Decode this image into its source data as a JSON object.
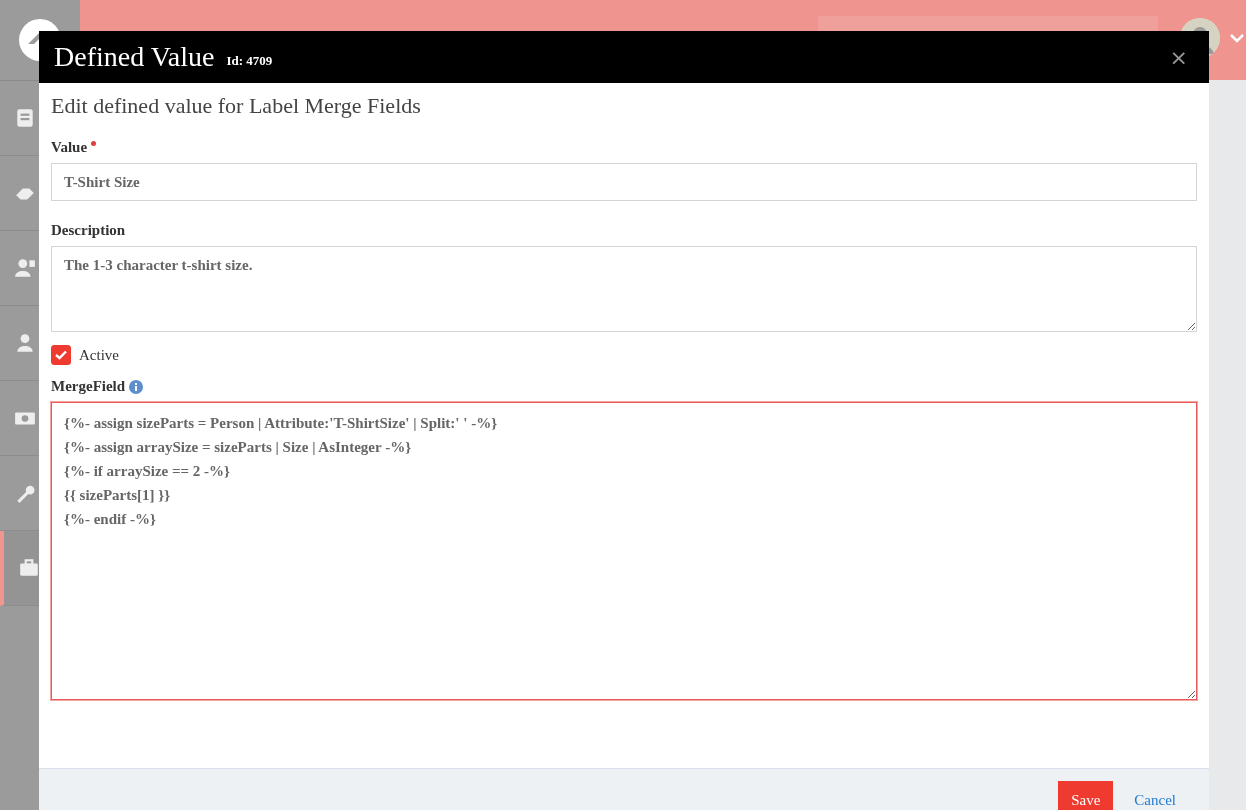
{
  "sidebar": {
    "items": [
      {
        "selected": false
      },
      {
        "selected": false
      },
      {
        "selected": false
      },
      {
        "selected": false
      },
      {
        "selected": false
      },
      {
        "selected": false
      },
      {
        "selected": true
      }
    ]
  },
  "dialog": {
    "title": "Defined Value",
    "id_label": "Id: 4709",
    "close": "×",
    "subtitle": "Edit defined value for Label Merge Fields",
    "fields": [
      {
        "kind": "text",
        "label": "Value",
        "required": true,
        "value": "T-Shirt Size"
      },
      {
        "kind": "textarea",
        "label": "Description",
        "required": false,
        "value": "The 1-3 character t-shirt size."
      },
      {
        "kind": "checkbox",
        "label": "Active",
        "checked": true
      },
      {
        "kind": "code",
        "label": "MergeField",
        "required": false,
        "info": true,
        "focused": true,
        "lines": [
          "{%- assign sizeParts = Person | Attribute:'T-ShirtSize' | Split:' ' -%}",
          "{%- assign arraySize = sizeParts | Size | AsInteger -%}",
          "{%- if arraySize == 2 -%}",
          "{{ sizeParts[1] }}",
          "{%- endif -%}"
        ]
      }
    ],
    "buttons": [
      {
        "kind": "primary",
        "label": "Save"
      },
      {
        "kind": "link",
        "label": "Cancel"
      }
    ]
  }
}
